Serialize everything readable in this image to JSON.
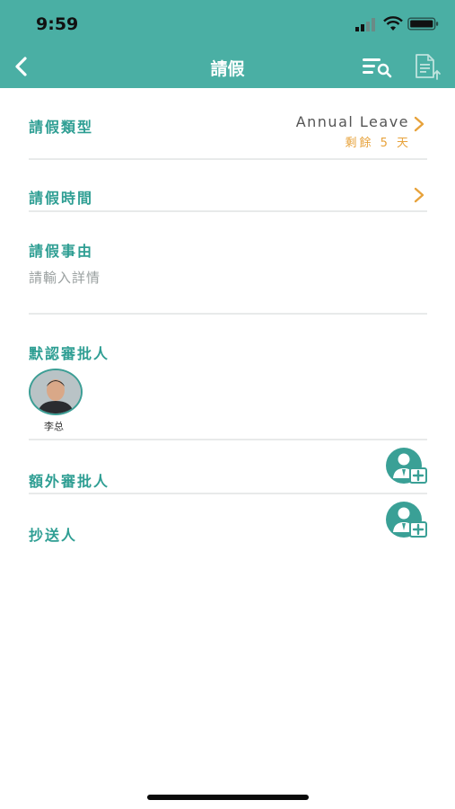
{
  "status_bar": {
    "time": "9:59"
  },
  "nav": {
    "title": "請假"
  },
  "form": {
    "leave_type": {
      "label": "請假類型",
      "value": "Annual Leave",
      "remaining": "剩餘 5 天"
    },
    "leave_time": {
      "label": "請假時間"
    },
    "leave_reason": {
      "label": "請假事由",
      "placeholder": "請輸入詳情"
    },
    "default_approver": {
      "label": "默認審批人",
      "approver_name": "李总"
    },
    "extra_approver": {
      "label": "額外審批人"
    },
    "cc": {
      "label": "抄送人"
    }
  },
  "colors": {
    "primary": "#4aafa4",
    "label": "#2e9e93",
    "accent": "#e7a23b"
  },
  "icons": {
    "back": "chevron-left-icon",
    "search_list": "list-search-icon",
    "upload": "document-upload-icon",
    "chevron": "chevron-right-icon",
    "add_person": "add-person-icon"
  }
}
